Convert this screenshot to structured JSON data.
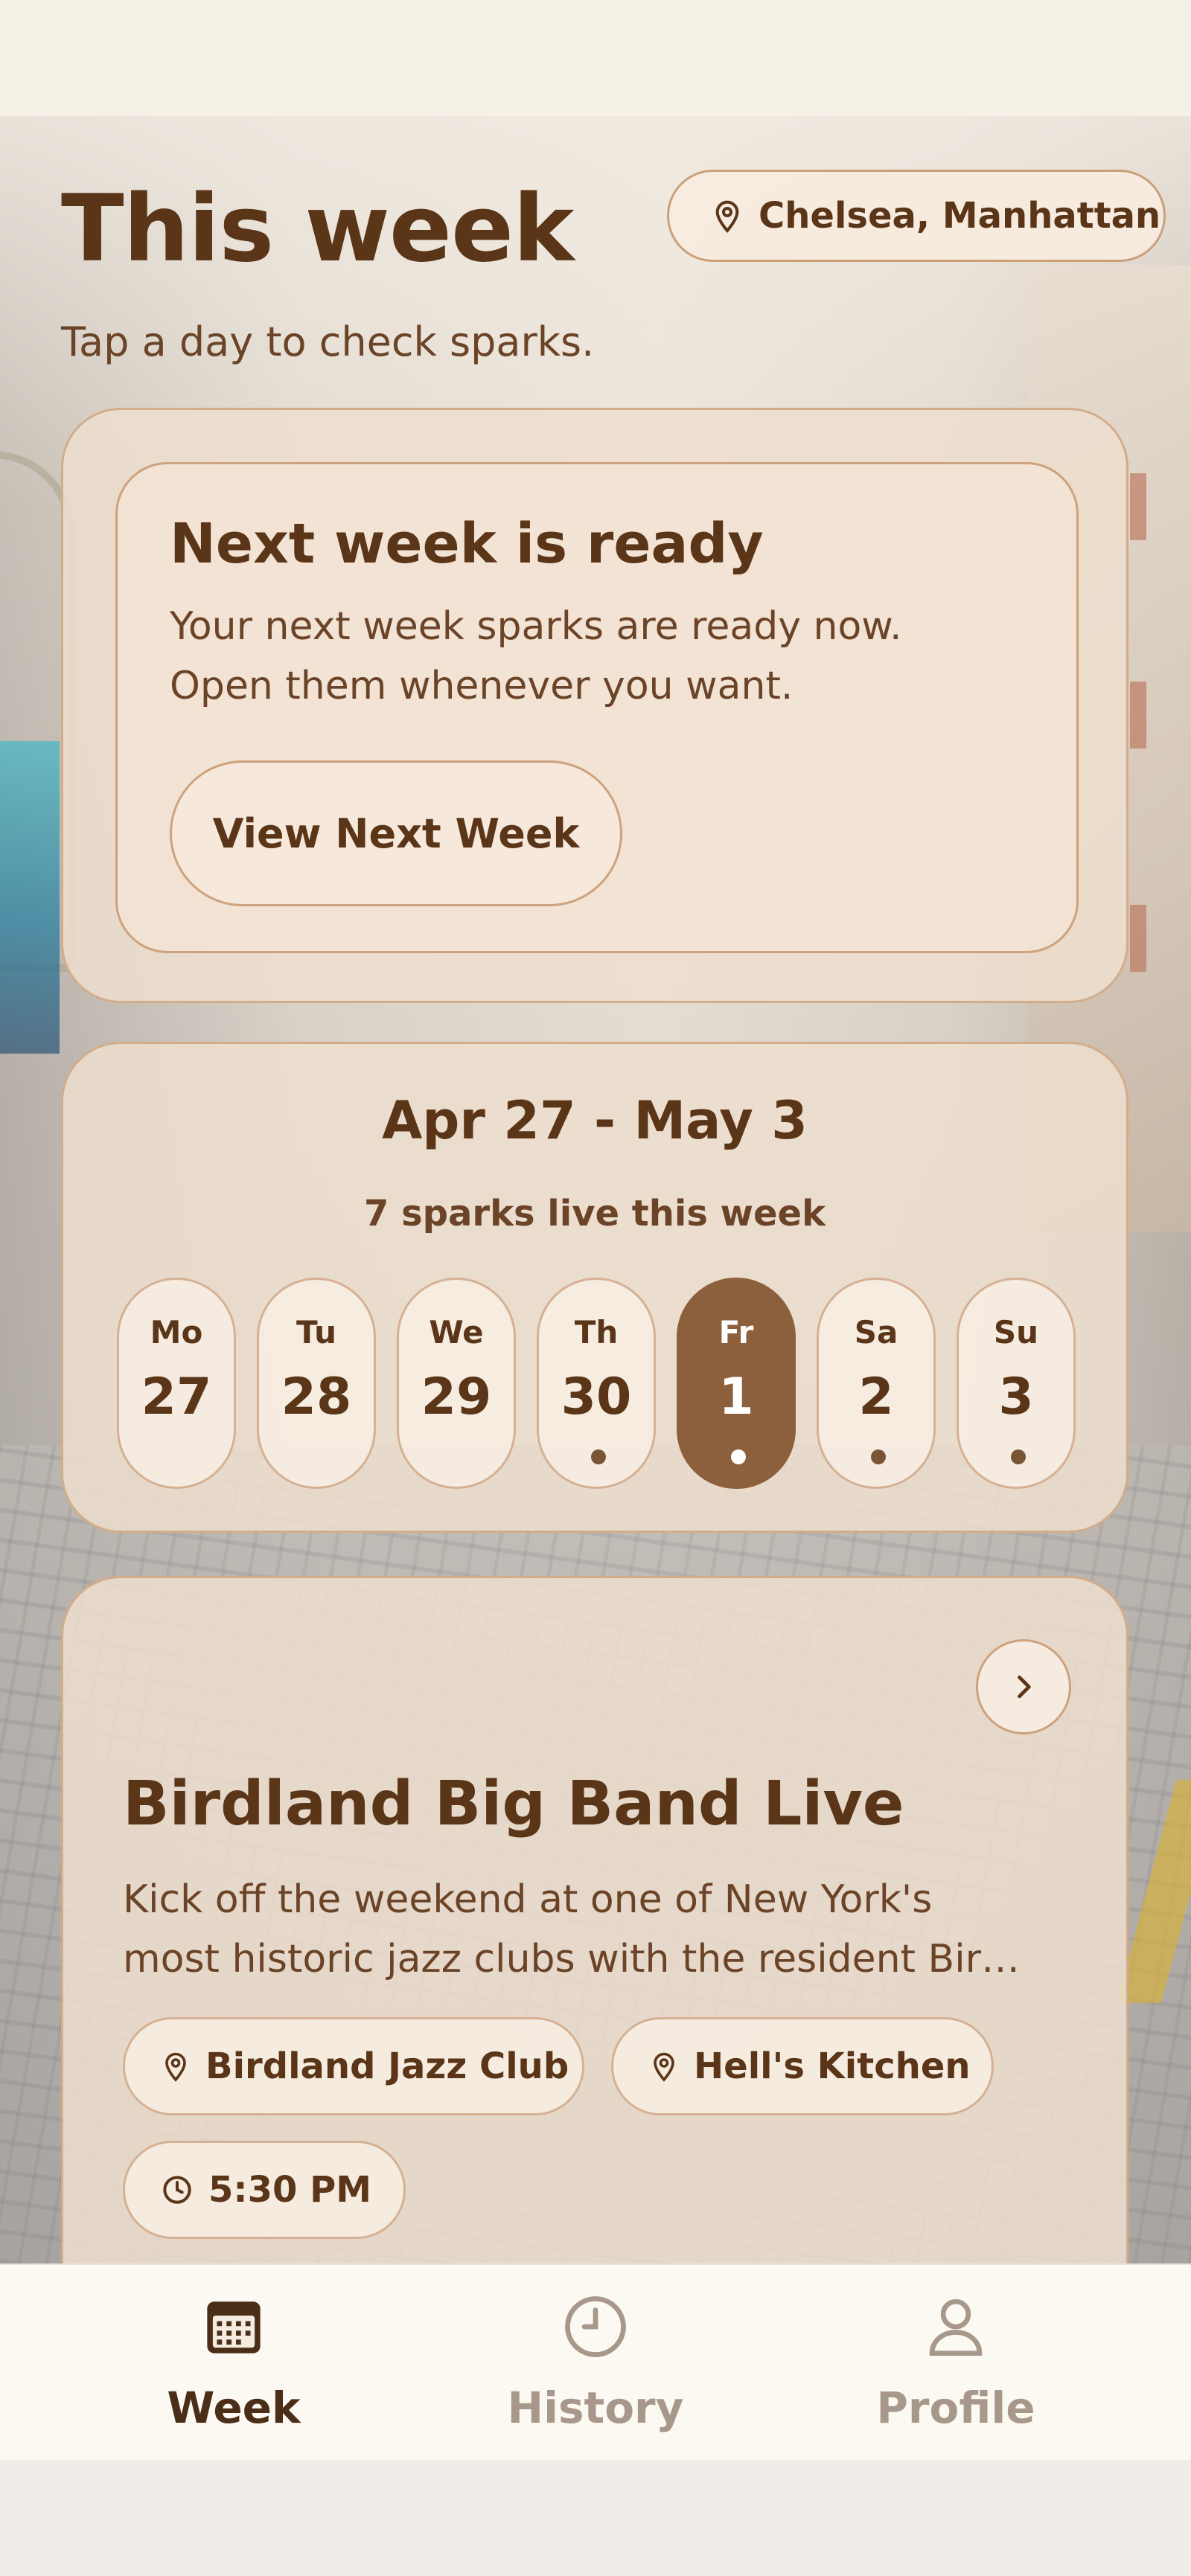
{
  "header": {
    "title": "This week",
    "subtitle": "Tap a day to check sparks.",
    "location": "Chelsea, Manhattan",
    "location_icon": "map-pin-icon"
  },
  "next_week": {
    "title": "Next week is ready",
    "line1": "Your next week sparks are ready now.",
    "line2": "Open them whenever you want.",
    "button_label": "View Next Week"
  },
  "week": {
    "range": "Apr 27 - May 3",
    "live_count": "7 sparks live this week",
    "days": [
      {
        "name": "Mo",
        "num": "27",
        "has_spark": false,
        "selected": false
      },
      {
        "name": "Tu",
        "num": "28",
        "has_spark": false,
        "selected": false
      },
      {
        "name": "We",
        "num": "29",
        "has_spark": false,
        "selected": false
      },
      {
        "name": "Th",
        "num": "30",
        "has_spark": true,
        "selected": false
      },
      {
        "name": "Fr",
        "num": "1",
        "has_spark": true,
        "selected": true
      },
      {
        "name": "Sa",
        "num": "2",
        "has_spark": true,
        "selected": false
      },
      {
        "name": "Su",
        "num": "3",
        "has_spark": true,
        "selected": false
      }
    ]
  },
  "event": {
    "title": "Birdland Big Band Live",
    "desc_line1": "Kick off the weekend at one of New York's",
    "desc_line2": "most historic jazz clubs with the resident Bir…",
    "venue": "Birdland Jazz Club",
    "neighborhood": "Hell's Kitchen",
    "time": "5:30 PM"
  },
  "nav": {
    "week": "Week",
    "history": "History",
    "profile": "Profile",
    "active": "week"
  },
  "colors": {
    "primary_text": "#5a3518",
    "accent": "#8c5f3d",
    "card_border": "#d2ad8b",
    "inactive_nav": "#a8988c"
  }
}
